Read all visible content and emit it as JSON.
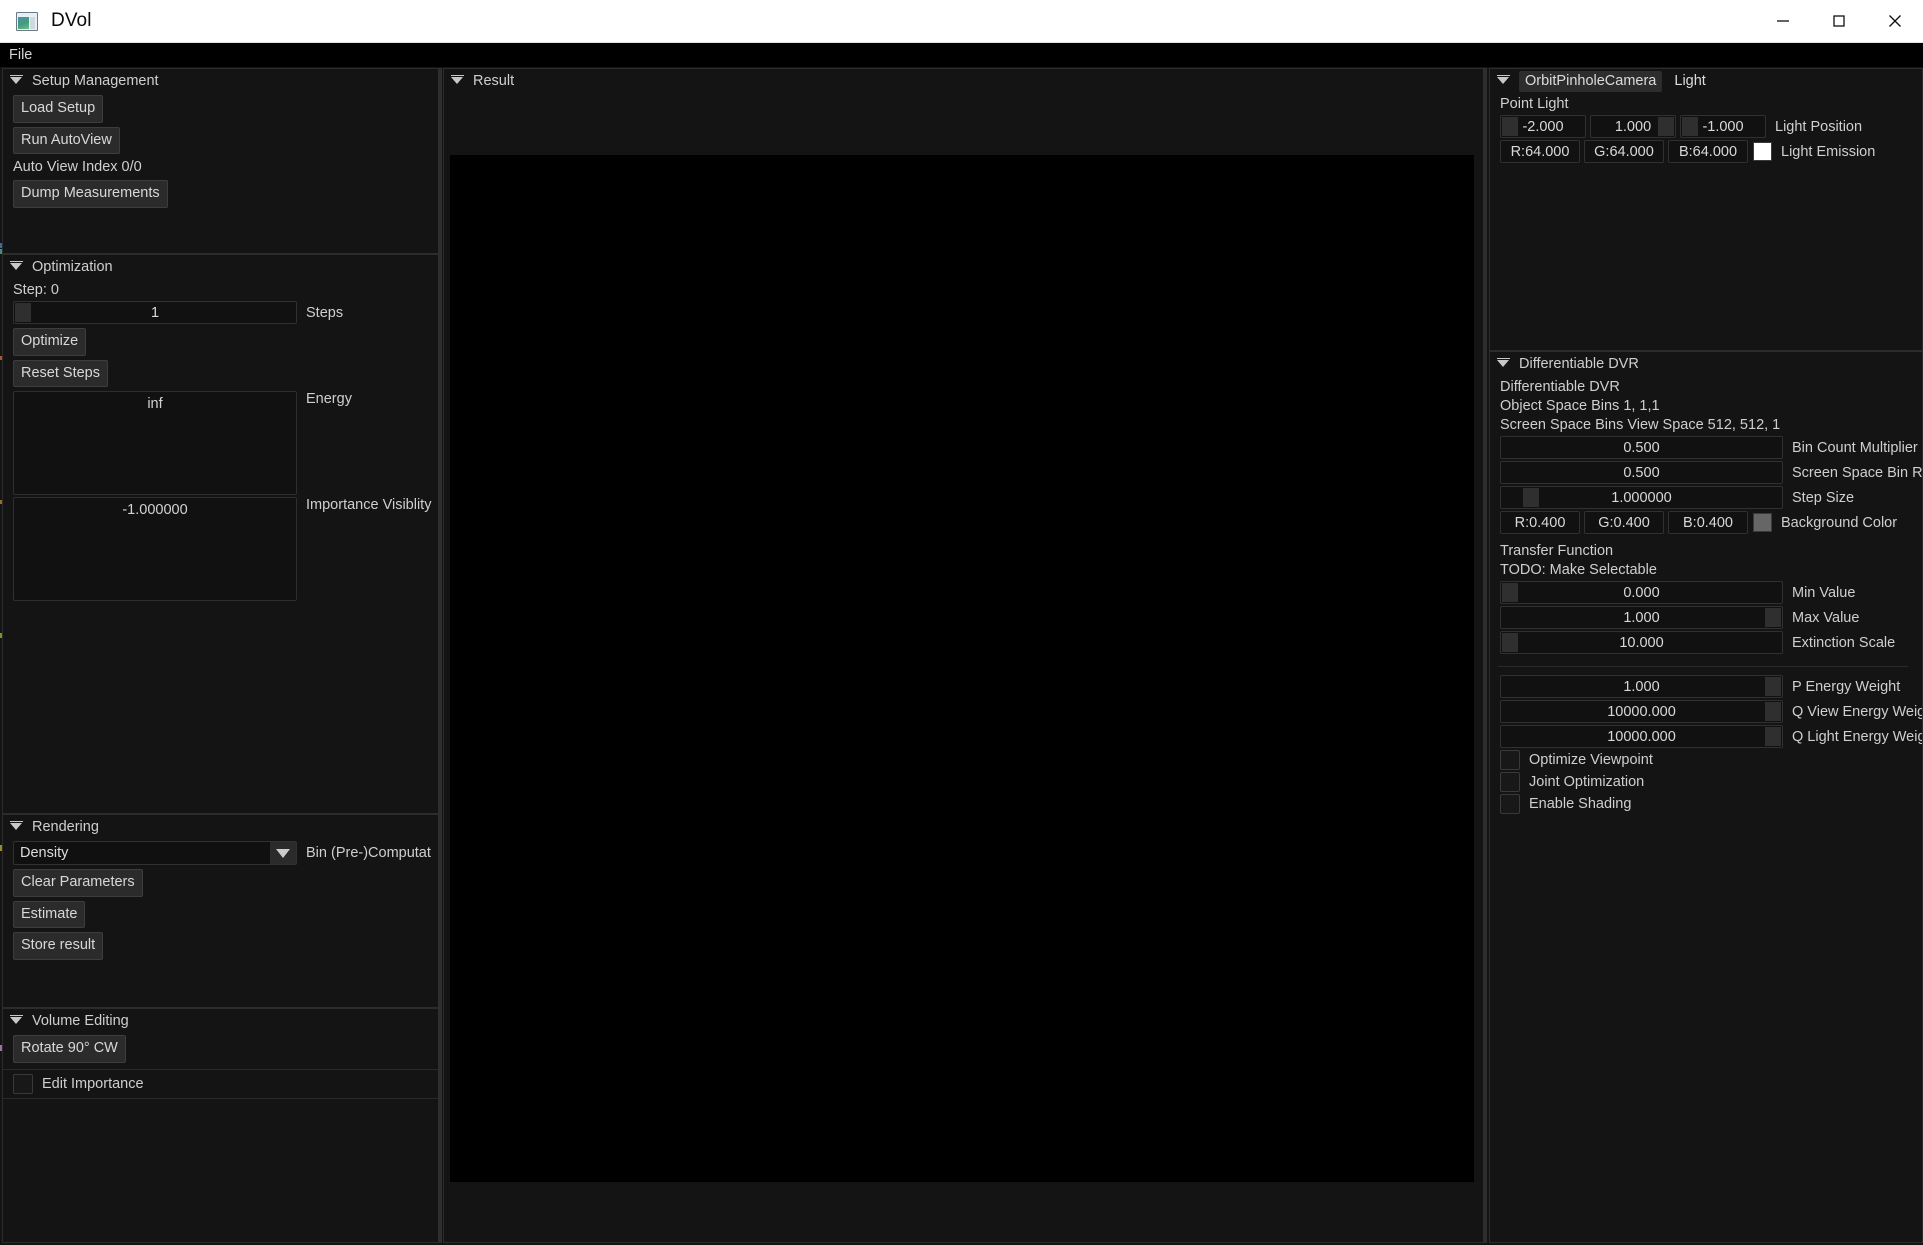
{
  "window": {
    "title": "DVol",
    "icon": "app-window-icon",
    "controls": {
      "minimize": "minimize-icon",
      "maximize": "maximize-icon",
      "close": "close-icon"
    }
  },
  "menubar": {
    "items": [
      {
        "label": "File"
      }
    ]
  },
  "left_panels": {
    "setup_management": {
      "title": "Setup Management",
      "load_setup": "Load Setup",
      "run_autoview": "Run AutoView",
      "auto_view_index": "Auto View Index 0/0",
      "dump_measurements": "Dump Measurements"
    },
    "optimization": {
      "title": "Optimization",
      "step_text": "Step: 0",
      "steps_value": "1",
      "steps_label": "Steps",
      "optimize": "Optimize",
      "reset_steps": "Reset Steps",
      "energy_value": "inf",
      "energy_label": "Energy",
      "importance_value": "-1.000000",
      "importance_label": "Importance Visiblity"
    },
    "rendering": {
      "title": "Rendering",
      "bin_mode_value": "Density",
      "bin_mode_label": "Bin (Pre-)Computat",
      "clear_parameters": "Clear Parameters",
      "estimate": "Estimate",
      "store_result": "Store result"
    },
    "volume_editing": {
      "title": "Volume Editing",
      "rotate": "Rotate 90° CW",
      "edit_importance": "Edit Importance",
      "edit_importance_checked": false
    }
  },
  "center_panel": {
    "title": "Result",
    "viewport_color": "#000000"
  },
  "right_panels": {
    "camera_light": {
      "tabs": [
        {
          "label": "OrbitPinholeCamera",
          "active": true
        },
        {
          "label": "Light",
          "active": false
        }
      ],
      "point_light_heading": "Point Light",
      "light_position": {
        "x": "-2.000",
        "y": "1.000",
        "z": "-1.000",
        "label": "Light Position"
      },
      "light_emission": {
        "r": "R:64.000",
        "g": "G:64.000",
        "b": "B:64.000",
        "swatch": "#ffffff",
        "label": "Light Emission"
      }
    },
    "ddvr": {
      "title": "Differentiable DVR",
      "heading": "Differentiable DVR",
      "object_space_bins": "Object Space Bins 1, 1,1",
      "screen_space_bins": "Screen Space Bins View Space 512, 512, 1",
      "bin_count_multiplier": {
        "value": "0.500",
        "label": "Bin Count Multiplier"
      },
      "screen_space_bin_r": {
        "value": "0.500",
        "label": "Screen Space Bin R"
      },
      "step_size": {
        "value": "1.000000",
        "label": "Step Size"
      },
      "background_color": {
        "r": "R:0.400",
        "g": "G:0.400",
        "b": "B:0.400",
        "swatch": "#666666",
        "label": "Background Color"
      },
      "transfer_function_heading": "Transfer Function",
      "transfer_function_todo": "TODO: Make Selectable",
      "min_value": {
        "value": "0.000",
        "label": "Min Value"
      },
      "max_value": {
        "value": "1.000",
        "label": "Max Value"
      },
      "extinction_scale": {
        "value": "10.000",
        "label": "Extinction Scale"
      },
      "p_energy_weight": {
        "value": "1.000",
        "label": "P Energy Weight"
      },
      "q_view_energy_weight": {
        "value": "10000.000",
        "label": "Q View Energy Weig"
      },
      "q_light_energy_weight": {
        "value": "10000.000",
        "label": "Q Light Energy Weig"
      },
      "optimize_viewpoint": {
        "label": "Optimize Viewpoint",
        "checked": false
      },
      "joint_optimization": {
        "label": "Joint Optimization",
        "checked": false
      },
      "enable_shading": {
        "label": "Enable Shading",
        "checked": false
      }
    }
  },
  "colors": {
    "panel_bg": "#141414",
    "widget_bg": "#111111",
    "button_bg": "#2b2b2b",
    "text": "#cfcfcf",
    "titlebar_bg": "#ffffff",
    "menubar_bg": "#000000"
  }
}
